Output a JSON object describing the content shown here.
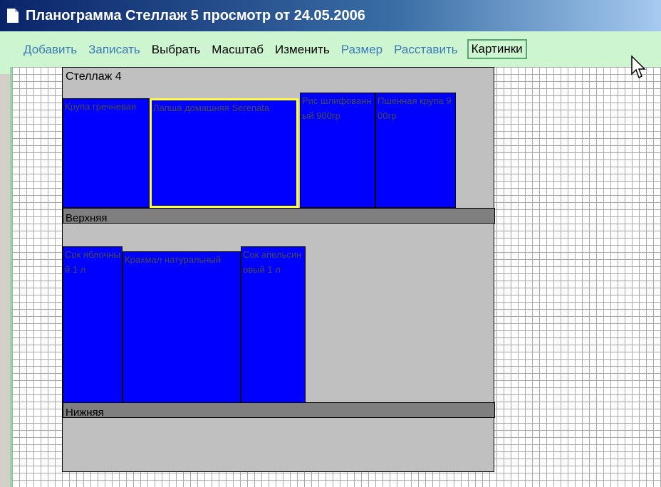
{
  "window": {
    "title": "Планограмма Стеллаж 5 просмотр от 24.05.2006"
  },
  "menu": {
    "items": [
      {
        "label": "Добавить",
        "state": "disabled"
      },
      {
        "label": "Записать",
        "state": "disabled"
      },
      {
        "label": "Выбрать",
        "state": "enabled"
      },
      {
        "label": "Масштаб",
        "state": "enabled"
      },
      {
        "label": "Изменить",
        "state": "enabled"
      },
      {
        "label": "Размер",
        "state": "disabled"
      },
      {
        "label": "Расставить",
        "state": "disabled"
      },
      {
        "label": "Картинки",
        "state": "active"
      }
    ]
  },
  "rack": {
    "title": "Стеллаж 4",
    "shelves": [
      {
        "label": "Верхняя",
        "products": [
          {
            "name": "Крупа гречневая"
          },
          {
            "name": "Лапша домашняя Serenata",
            "selected": true
          },
          {
            "name": "Рис шлифованный 900гр"
          },
          {
            "name": "Пшенная крупа 900гр"
          }
        ]
      },
      {
        "label": "Нижняя",
        "products": [
          {
            "name": "Сок яблочный 1 л"
          },
          {
            "name": "Крахмал натуральный"
          },
          {
            "name": "Сок апельсиновый 1 л"
          }
        ]
      }
    ]
  },
  "colors": {
    "product_fill": "#0000ff",
    "selected_border": "#ffff33",
    "menu_bg": "#ccf5d0",
    "rack_bg": "#c0c0c0",
    "shelf_bg": "#7f7f7f"
  }
}
